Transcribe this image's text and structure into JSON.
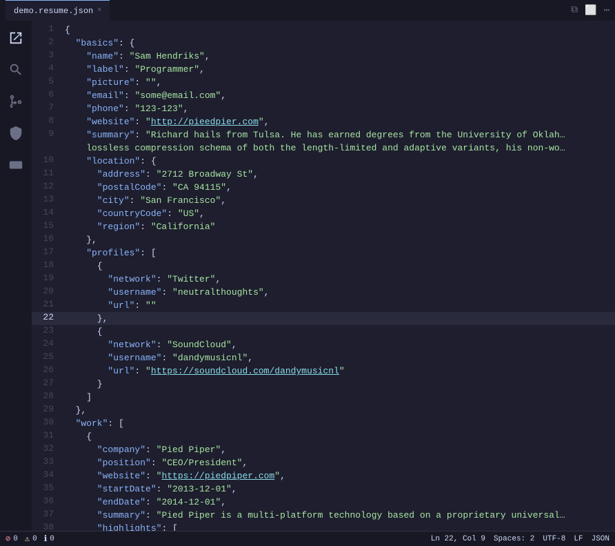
{
  "titleBar": {
    "tab": {
      "label": "demo.resume.json",
      "close": "×"
    },
    "icons": [
      "⧉",
      "⬜",
      "⋯"
    ]
  },
  "activityBar": {
    "icons": [
      {
        "name": "files-icon",
        "glyph": "🗋",
        "active": true
      },
      {
        "name": "search-icon",
        "glyph": "🔍"
      },
      {
        "name": "source-control-icon",
        "glyph": "⎇"
      },
      {
        "name": "extensions-icon",
        "glyph": "⊞"
      },
      {
        "name": "remote-icon",
        "glyph": "⊙"
      }
    ]
  },
  "lines": [
    {
      "n": 1,
      "tokens": [
        {
          "t": "punct",
          "v": "{"
        }
      ]
    },
    {
      "n": 2,
      "tokens": [
        {
          "t": "key",
          "v": "  \"basics\""
        },
        {
          "t": "colon",
          "v": ": "
        },
        {
          "t": "punct",
          "v": "{"
        }
      ]
    },
    {
      "n": 3,
      "tokens": [
        {
          "t": "key",
          "v": "    \"name\""
        },
        {
          "t": "colon",
          "v": ": "
        },
        {
          "t": "str",
          "v": "\"Sam Hendriks\""
        },
        {
          "t": "punct",
          "v": ","
        }
      ]
    },
    {
      "n": 4,
      "tokens": [
        {
          "t": "key",
          "v": "    \"label\""
        },
        {
          "t": "colon",
          "v": ": "
        },
        {
          "t": "str",
          "v": "\"Programmer\""
        },
        {
          "t": "punct",
          "v": ","
        }
      ]
    },
    {
      "n": 5,
      "tokens": [
        {
          "t": "key",
          "v": "    \"picture\""
        },
        {
          "t": "colon",
          "v": ": "
        },
        {
          "t": "str",
          "v": "\"\""
        },
        {
          "t": "punct",
          "v": ","
        }
      ]
    },
    {
      "n": 6,
      "tokens": [
        {
          "t": "key",
          "v": "    \"email\""
        },
        {
          "t": "colon",
          "v": ": "
        },
        {
          "t": "str",
          "v": "\"some@email.com\""
        },
        {
          "t": "punct",
          "v": ","
        }
      ]
    },
    {
      "n": 7,
      "tokens": [
        {
          "t": "key",
          "v": "    \"phone\""
        },
        {
          "t": "colon",
          "v": ": "
        },
        {
          "t": "str",
          "v": "\"123-123\""
        },
        {
          "t": "punct",
          "v": ","
        }
      ]
    },
    {
      "n": 8,
      "tokens": [
        {
          "t": "key",
          "v": "    \"website\""
        },
        {
          "t": "colon",
          "v": ": "
        },
        {
          "t": "str",
          "v": "\""
        },
        {
          "t": "link",
          "v": "http://pieedpier.com"
        },
        {
          "t": "str",
          "v": "\""
        },
        {
          "t": "punct",
          "v": ","
        }
      ]
    },
    {
      "n": 9,
      "tokens": [
        {
          "t": "key",
          "v": "    \"summary\""
        },
        {
          "t": "colon",
          "v": ": "
        },
        {
          "t": "str",
          "v": "\"Richard hails from Tulsa. He has earned degrees from the University of Oklah"
        }
      ],
      "overflow": true
    },
    {
      "n": 9,
      "continuation": true,
      "tokens": [
        {
          "t": "str",
          "v": "    lossless compression schema of both the length-limited and adaptive variants, his non-wo"
        }
      ],
      "overflow": true
    },
    {
      "n": 10,
      "tokens": [
        {
          "t": "key",
          "v": "    \"location\""
        },
        {
          "t": "colon",
          "v": ": "
        },
        {
          "t": "punct",
          "v": "{"
        }
      ]
    },
    {
      "n": 11,
      "tokens": [
        {
          "t": "key",
          "v": "      \"address\""
        },
        {
          "t": "colon",
          "v": ": "
        },
        {
          "t": "str",
          "v": "\"2712 Broadway St\""
        },
        {
          "t": "punct",
          "v": ","
        }
      ]
    },
    {
      "n": 12,
      "tokens": [
        {
          "t": "key",
          "v": "      \"postalCode\""
        },
        {
          "t": "colon",
          "v": ": "
        },
        {
          "t": "str",
          "v": "\"CA 94115\""
        },
        {
          "t": "punct",
          "v": ","
        }
      ]
    },
    {
      "n": 13,
      "tokens": [
        {
          "t": "key",
          "v": "      \"city\""
        },
        {
          "t": "colon",
          "v": ": "
        },
        {
          "t": "str",
          "v": "\"San Francisco\""
        },
        {
          "t": "punct",
          "v": ","
        }
      ]
    },
    {
      "n": 14,
      "tokens": [
        {
          "t": "key",
          "v": "      \"countryCode\""
        },
        {
          "t": "colon",
          "v": ": "
        },
        {
          "t": "str",
          "v": "\"US\""
        },
        {
          "t": "punct",
          "v": ","
        }
      ]
    },
    {
      "n": 15,
      "tokens": [
        {
          "t": "key",
          "v": "      \"region\""
        },
        {
          "t": "colon",
          "v": ": "
        },
        {
          "t": "str",
          "v": "\"California\""
        }
      ]
    },
    {
      "n": 16,
      "tokens": [
        {
          "t": "punct",
          "v": "    },"
        }
      ]
    },
    {
      "n": 17,
      "tokens": [
        {
          "t": "key",
          "v": "    \"profiles\""
        },
        {
          "t": "colon",
          "v": ": "
        },
        {
          "t": "punct",
          "v": "["
        }
      ]
    },
    {
      "n": 18,
      "tokens": [
        {
          "t": "punct",
          "v": "      {"
        }
      ]
    },
    {
      "n": 19,
      "tokens": [
        {
          "t": "key",
          "v": "        \"network\""
        },
        {
          "t": "colon",
          "v": ": "
        },
        {
          "t": "str",
          "v": "\"Twitter\""
        },
        {
          "t": "punct",
          "v": ","
        }
      ]
    },
    {
      "n": 20,
      "tokens": [
        {
          "t": "key",
          "v": "        \"username\""
        },
        {
          "t": "colon",
          "v": ": "
        },
        {
          "t": "str",
          "v": "\"neutralthoughts\""
        },
        {
          "t": "punct",
          "v": ","
        }
      ]
    },
    {
      "n": 21,
      "tokens": [
        {
          "t": "key",
          "v": "        \"url\""
        },
        {
          "t": "colon",
          "v": ": "
        },
        {
          "t": "str",
          "v": "\"\""
        }
      ]
    },
    {
      "n": 22,
      "tokens": [
        {
          "t": "punct",
          "v": "      },"
        }
      ],
      "active": true
    },
    {
      "n": 23,
      "tokens": [
        {
          "t": "punct",
          "v": "      {"
        }
      ]
    },
    {
      "n": 24,
      "tokens": [
        {
          "t": "key",
          "v": "        \"network\""
        },
        {
          "t": "colon",
          "v": ": "
        },
        {
          "t": "str",
          "v": "\"SoundCloud\""
        },
        {
          "t": "punct",
          "v": ","
        }
      ]
    },
    {
      "n": 25,
      "tokens": [
        {
          "t": "key",
          "v": "        \"username\""
        },
        {
          "t": "colon",
          "v": ": "
        },
        {
          "t": "str",
          "v": "\"dandymusicnl\""
        },
        {
          "t": "punct",
          "v": ","
        }
      ]
    },
    {
      "n": 26,
      "tokens": [
        {
          "t": "key",
          "v": "        \"url\""
        },
        {
          "t": "colon",
          "v": ": "
        },
        {
          "t": "str",
          "v": "\""
        },
        {
          "t": "link",
          "v": "https://soundcloud.com/dandymusicnl"
        },
        {
          "t": "str",
          "v": "\""
        }
      ]
    },
    {
      "n": 27,
      "tokens": [
        {
          "t": "punct",
          "v": "      }"
        }
      ]
    },
    {
      "n": 28,
      "tokens": [
        {
          "t": "punct",
          "v": "    ]"
        }
      ]
    },
    {
      "n": 29,
      "tokens": [
        {
          "t": "punct",
          "v": "  },"
        }
      ]
    },
    {
      "n": 30,
      "tokens": [
        {
          "t": "key",
          "v": "  \"work\""
        },
        {
          "t": "colon",
          "v": ": "
        },
        {
          "t": "punct",
          "v": "["
        }
      ]
    },
    {
      "n": 31,
      "tokens": [
        {
          "t": "punct",
          "v": "    {"
        }
      ]
    },
    {
      "n": 32,
      "tokens": [
        {
          "t": "key",
          "v": "      \"company\""
        },
        {
          "t": "colon",
          "v": ": "
        },
        {
          "t": "str",
          "v": "\"Pied Piper\""
        },
        {
          "t": "punct",
          "v": ","
        }
      ]
    },
    {
      "n": 33,
      "tokens": [
        {
          "t": "key",
          "v": "      \"position\""
        },
        {
          "t": "colon",
          "v": ": "
        },
        {
          "t": "str",
          "v": "\"CEO/President\""
        },
        {
          "t": "punct",
          "v": ","
        }
      ]
    },
    {
      "n": 34,
      "tokens": [
        {
          "t": "key",
          "v": "      \"website\""
        },
        {
          "t": "colon",
          "v": ": "
        },
        {
          "t": "str",
          "v": "\""
        },
        {
          "t": "link",
          "v": "https://piedpiper.com"
        },
        {
          "t": "str",
          "v": "\""
        },
        {
          "t": "punct",
          "v": ","
        }
      ]
    },
    {
      "n": 35,
      "tokens": [
        {
          "t": "key",
          "v": "      \"startDate\""
        },
        {
          "t": "colon",
          "v": ": "
        },
        {
          "t": "str",
          "v": "\"2013-12-01\""
        },
        {
          "t": "punct",
          "v": ","
        }
      ]
    },
    {
      "n": 36,
      "tokens": [
        {
          "t": "key",
          "v": "      \"endDate\""
        },
        {
          "t": "colon",
          "v": ": "
        },
        {
          "t": "str",
          "v": "\"2014-12-01\""
        },
        {
          "t": "punct",
          "v": ","
        }
      ]
    },
    {
      "n": 37,
      "tokens": [
        {
          "t": "key",
          "v": "      \"summary\""
        },
        {
          "t": "colon",
          "v": ": "
        },
        {
          "t": "str",
          "v": "\"Pied Piper is a multi-platform technology based on a proprietary universal"
        }
      ],
      "overflow": true
    },
    {
      "n": 38,
      "tokens": [
        {
          "t": "key",
          "v": "      \"highlights\""
        },
        {
          "t": "colon",
          "v": ": "
        },
        {
          "t": "punct",
          "v": "["
        }
      ]
    }
  ],
  "statusBar": {
    "left": [
      {
        "icon": "⊙",
        "label": "0"
      },
      {
        "icon": "⚠",
        "label": "0"
      },
      {
        "icon": "ℹ",
        "label": "0"
      }
    ],
    "right": [
      {
        "label": "Ln 22, Col 9"
      },
      {
        "label": "Spaces: 2"
      },
      {
        "label": "UTF-8"
      },
      {
        "label": "LF"
      },
      {
        "label": "JSON"
      }
    ]
  }
}
